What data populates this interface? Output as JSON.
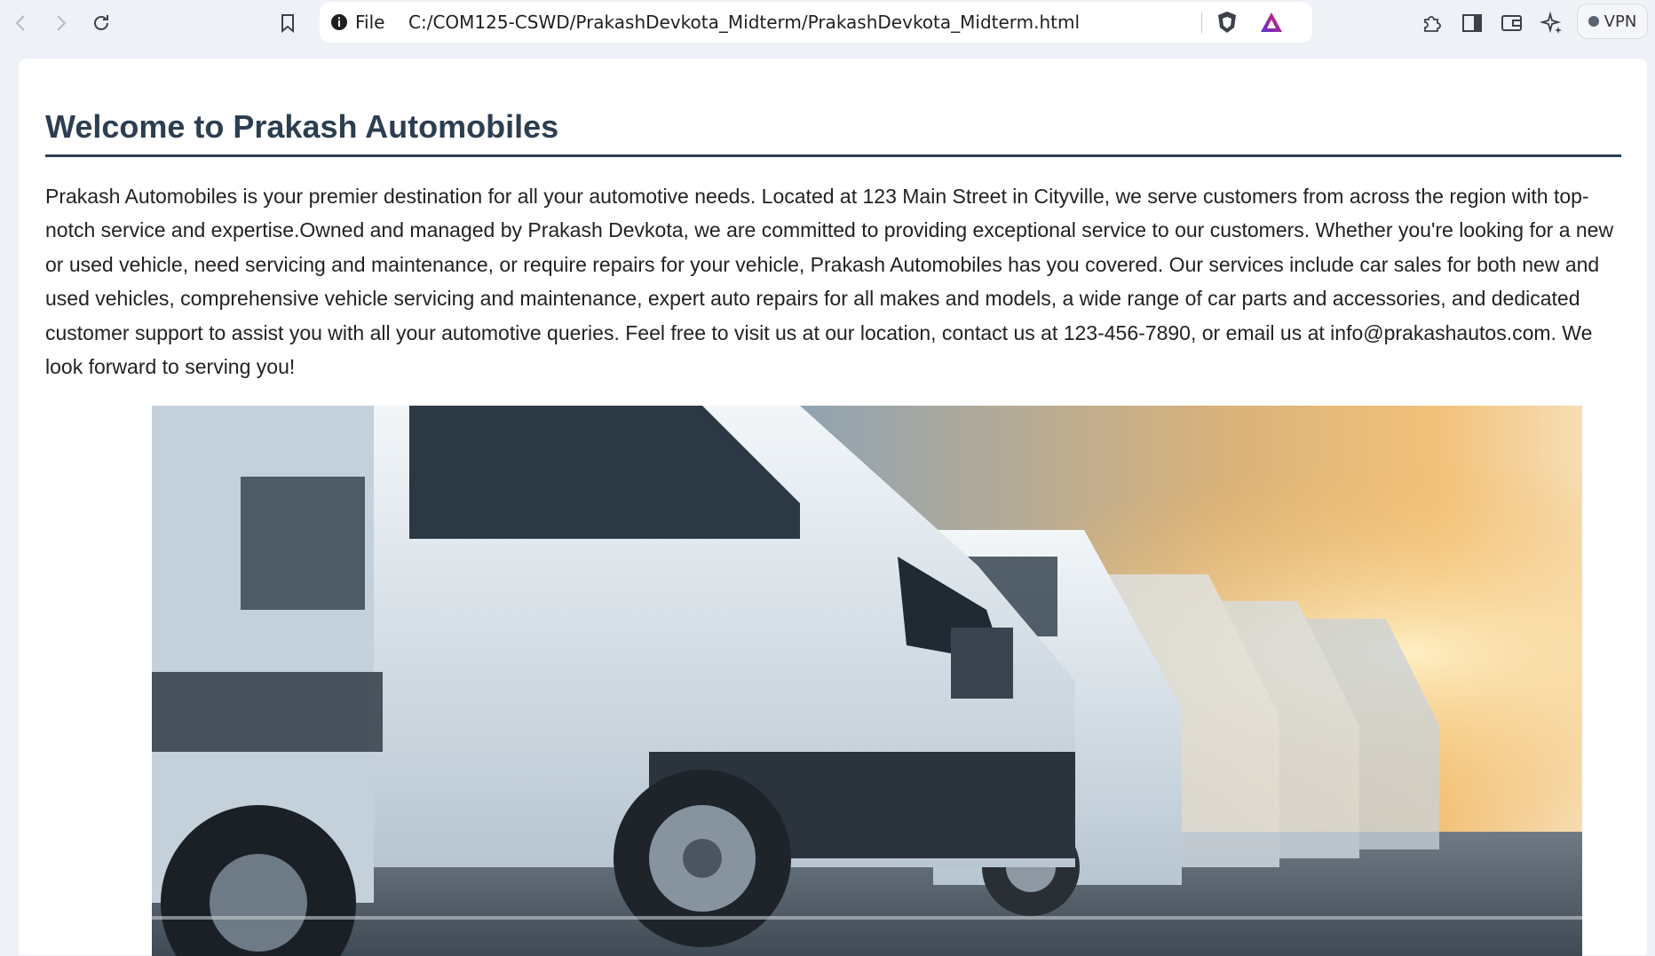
{
  "browser": {
    "site_info_label": "File",
    "url": "C:/COM125-CSWD/PrakashDevkota_Midterm/PrakashDevkota_Midterm.html",
    "vpn_label": "VPN",
    "icons": [
      "back-icon",
      "forward-icon",
      "reload-icon",
      "bookmark-icon",
      "info-icon",
      "brave-shield-icon",
      "brave-rewards-icon",
      "extensions-icon",
      "sidebar-icon",
      "wallet-icon",
      "leo-ai-icon"
    ]
  },
  "page": {
    "heading": "Welcome to Prakash Automobiles",
    "intro": "Prakash Automobiles is your premier destination for all your automotive needs. Located at 123 Main Street in Cityville, we serve customers from across the region with top-notch service and expertise.Owned and managed by Prakash Devkota, we are committed to providing exceptional service to our customers. Whether you're looking for a new or used vehicle, need servicing and maintenance, or require repairs for your vehicle, Prakash Automobiles has you covered. Our services include car sales for both new and used vehicles, comprehensive vehicle servicing and maintenance, expert auto repairs for all makes and models, a wide range of car parts and accessories, and dedicated customer support to assist you with all your automotive queries. Feel free to visit us at our location, contact us at 123-456-7890, or email us at info@prakashautos.com. We look forward to serving you!",
    "colors": {
      "heading": "#2c3e50",
      "text": "#222222",
      "page_bg": "#ffffff",
      "chrome_bg": "#eef1f6"
    }
  }
}
